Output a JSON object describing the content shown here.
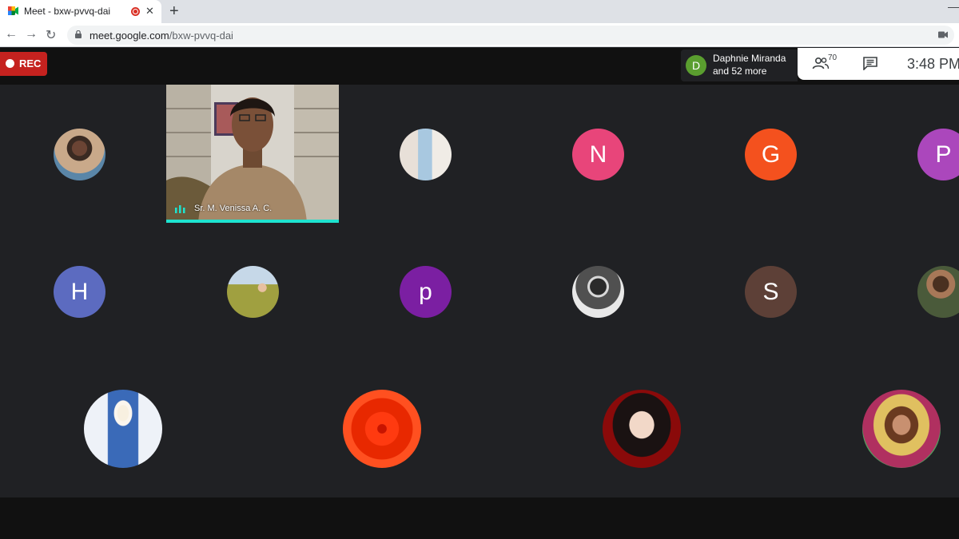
{
  "browser": {
    "tab_title": "Meet - bxw-pvvq-dai",
    "close_glyph": "✕",
    "new_tab_glyph": "+",
    "minimize_glyph": "—",
    "back_glyph": "←",
    "forward_glyph": "→",
    "reload_glyph": "↻",
    "url_host": "meet.google.com",
    "url_path": "/bxw-pvvq-dai"
  },
  "meet": {
    "rec_label": "REC",
    "presenter_initial": "D",
    "presenter_name": "Daphnie Miranda",
    "presenter_more": "and 52 more",
    "people_count": "70",
    "time": "3:48 PM",
    "accent_color": "#1ee3cf",
    "rec_color": "#c5221f"
  },
  "speaker": {
    "name": "Sr. M. Venissa A. C."
  },
  "participants": {
    "row1": [
      "N",
      "G",
      "P"
    ],
    "row2": [
      "H",
      "p",
      "S"
    ]
  },
  "avatar_colors": {
    "N": "#e8457a",
    "G": "#f4511e",
    "P": "#ab47bc",
    "H": "#5c6bc0",
    "p": "#7b1fa2",
    "S": "#5d4037",
    "D": "#5a9e2f"
  },
  "icons": [
    "meet-favicon-icon",
    "record-dot-icon",
    "lock-icon",
    "camera-icon",
    "people-icon",
    "chat-icon",
    "audio-level-icon"
  ]
}
